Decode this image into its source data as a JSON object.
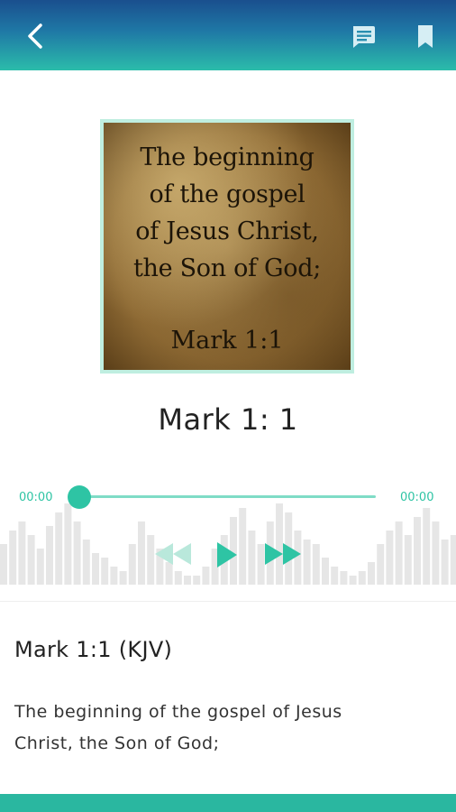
{
  "header": {
    "back_icon": "back-chevron-icon",
    "comment_icon": "comment-icon",
    "bookmark_icon": "bookmark-icon",
    "gradient_colors": [
      "#1a4f8e",
      "#1f79a6",
      "#2bbcaa"
    ]
  },
  "verse_image": {
    "lines": [
      "The beginning",
      "of the gospel",
      "of Jesus Christ,",
      "the Son of God;"
    ],
    "reference": "Mark 1:1"
  },
  "player": {
    "title": "Mark 1: 1",
    "current_time": "00:00",
    "total_time": "00:00",
    "progress": 0,
    "accent_color": "#2ec4a4",
    "controls": {
      "rewind_icon": "rewind-icon",
      "play_icon": "play-icon",
      "forward_icon": "fast-forward-icon"
    }
  },
  "verse": {
    "reference": "Mark 1:1 (KJV)",
    "text": "The beginning of the gospel of Jesus Christ, the Son of God;"
  },
  "colors": {
    "bottom_bar": "#2ab7a0"
  }
}
